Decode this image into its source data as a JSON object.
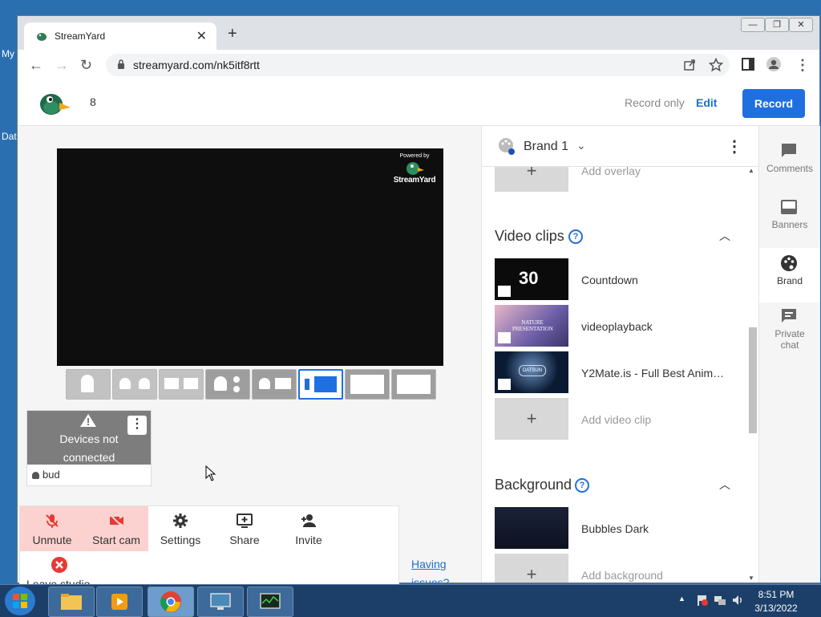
{
  "desktop": {
    "icon_labels": [
      "My",
      "Dat"
    ]
  },
  "browser": {
    "tab_title": "StreamYard",
    "url": "streamyard.com/nk5itf8rtt",
    "window_controls": [
      "minimize",
      "restore",
      "close"
    ]
  },
  "header": {
    "count": "8",
    "record_only": "Record only",
    "edit": "Edit",
    "record": "Record"
  },
  "stage": {
    "powered_by": "Powered by",
    "brand_watermark": "StreamYard"
  },
  "layouts": {
    "selected_index": 5
  },
  "guest_tile": {
    "status_line1": "Devices not",
    "status_line2": "connected",
    "name": "bud"
  },
  "controls": {
    "unmute": "Unmute",
    "start_cam": "Start cam",
    "settings": "Settings",
    "share": "Share",
    "invite": "Invite",
    "leave": "Leave studio"
  },
  "help_link": {
    "line1": "Having",
    "line2": "issues?"
  },
  "brand_panel": {
    "brand_name": "Brand 1",
    "add_overlay": "Add overlay",
    "video_clips_title": "Video clips",
    "video_clips": [
      {
        "label": "Countdown",
        "thumb_text": "30"
      },
      {
        "label": "videoplayback",
        "thumb_text": "NATURE PRESENTATION"
      },
      {
        "label": "Y2Mate.is - Full Best Anim…",
        "thumb_text": "DATSUN"
      }
    ],
    "add_video_clip": "Add video clip",
    "background_title": "Background",
    "backgrounds": [
      {
        "label": "Bubbles Dark"
      }
    ],
    "add_background": "Add background"
  },
  "sidebar": {
    "items": [
      {
        "label": "Comments"
      },
      {
        "label": "Banners"
      },
      {
        "label": "Brand"
      },
      {
        "label": "Private chat"
      }
    ]
  },
  "taskbar": {
    "time": "8:51 PM",
    "date": "3/13/2022"
  },
  "colors": {
    "accent": "#1f6fe0",
    "danger_bg": "#fbd2d0",
    "danger": "#e53935"
  }
}
